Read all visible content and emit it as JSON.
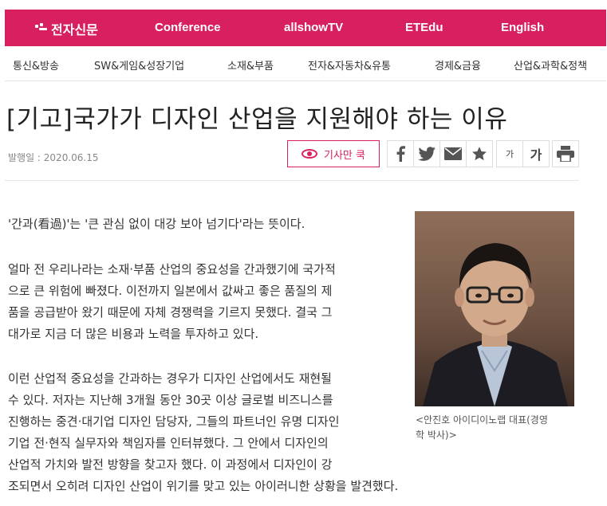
{
  "header": {
    "logo_text": "전자신문",
    "nav": [
      "Conference",
      "allshowTV",
      "ETEdu",
      "English"
    ]
  },
  "categories": [
    "통신&방송",
    "SW&게임&성장기업",
    "소재&부품",
    "전자&자동차&유통",
    "경제&금융",
    "산업&과학&정책"
  ],
  "article": {
    "title": "[기고]국가가 디자인 산업을 지원해야 하는 이유",
    "date": "발행일 : 2020.06.15",
    "listen_label": "기사만 쿡",
    "tools": {
      "font_small": "가",
      "font_large": "가"
    },
    "paragraphs": [
      [
        "'간과(看過)'는 '큰 관심 없이 대강 보아 넘기다'라는 뜻이다."
      ],
      [
        "얼마 전 우리나라는 소재·부품 산업의 중요성을 간과했기에 국가적",
        "으로 큰 위험에 빠졌다. 이전까지 일본에서 값싸고 좋은 품질의 제",
        "품을 공급받아 왔기 때문에 자체 경쟁력을 기르지 못했다. 결국 그",
        "대가로 지금 더 많은 비용과 노력을 투자하고 있다."
      ],
      [
        "이런 산업적 중요성을 간과하는 경우가 디자인 산업에서도 재현될",
        "수 있다. 저자는 지난해 3개월 동안 30곳 이상 글로벌 비즈니스를",
        "진행하는 중견·대기업 디자인 담당자, 그들의 파트너인 유명 디자인",
        "기업 전·현직 실무자와 책임자를 인터뷰했다. 그 안에서 디자인의",
        "산업적 가치와 발전 방향을 찾고자 했다. 이 과정에서 디자인이 강",
        "조되면서 오히려 디자인 산업이 위기를 맞고 있는 아이러니한 상황을 발견했다."
      ]
    ],
    "photo_caption": [
      "<안진호 아이디이노랩 대표(경영",
      "학 박사)>"
    ]
  },
  "colors": {
    "brand": "#d81f5f"
  }
}
